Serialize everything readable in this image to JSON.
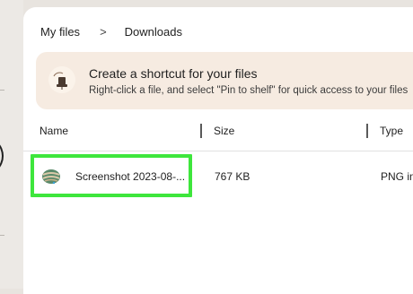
{
  "breadcrumb": {
    "root": "My files",
    "separator": ">",
    "current": "Downloads"
  },
  "banner": {
    "title": "Create a shortcut for your files",
    "description": "Right-click a file, and select \"Pin to shelf\" for quick access to your files",
    "icon": "pin-illustration-icon"
  },
  "columns": {
    "name": "Name",
    "size": "Size",
    "type": "Type"
  },
  "files": [
    {
      "name": "Screenshot 2023-08-...",
      "size": "767 KB",
      "type": "PNG im",
      "icon": "image-thumbnail-icon",
      "highlighted": true
    }
  ],
  "colors": {
    "highlight": "#3ee63c",
    "banner_bg": "#f6ebe1",
    "app_bg": "#e8e4df"
  }
}
